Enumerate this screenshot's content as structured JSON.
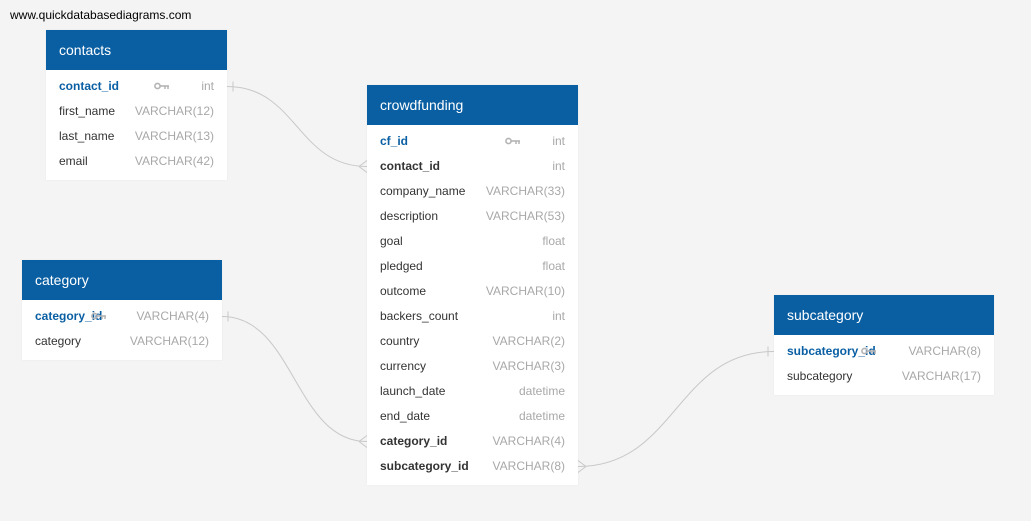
{
  "site": "www.quickdatabasediagrams.com",
  "colors": {
    "header": "#0a5fa3",
    "primary_key": "#0a5fa3",
    "type": "#a8a8a8",
    "link": "#c8c8c8",
    "background": "#f3f4f3"
  },
  "tables": {
    "contacts": {
      "title": "contacts",
      "columns": [
        {
          "name": "contact_id",
          "type": "int",
          "pk": true,
          "fk": false
        },
        {
          "name": "first_name",
          "type": "VARCHAR(12)",
          "pk": false,
          "fk": false
        },
        {
          "name": "last_name",
          "type": "VARCHAR(13)",
          "pk": false,
          "fk": false
        },
        {
          "name": "email",
          "type": "VARCHAR(42)",
          "pk": false,
          "fk": false
        }
      ]
    },
    "category": {
      "title": "category",
      "columns": [
        {
          "name": "category_id",
          "type": "VARCHAR(4)",
          "pk": true,
          "fk": false
        },
        {
          "name": "category",
          "type": "VARCHAR(12)",
          "pk": false,
          "fk": false
        }
      ]
    },
    "crowdfunding": {
      "title": "crowdfunding",
      "columns": [
        {
          "name": "cf_id",
          "type": "int",
          "pk": true,
          "fk": false
        },
        {
          "name": "contact_id",
          "type": "int",
          "pk": false,
          "fk": true
        },
        {
          "name": "company_name",
          "type": "VARCHAR(33)",
          "pk": false,
          "fk": false
        },
        {
          "name": "description",
          "type": "VARCHAR(53)",
          "pk": false,
          "fk": false
        },
        {
          "name": "goal",
          "type": "float",
          "pk": false,
          "fk": false
        },
        {
          "name": "pledged",
          "type": "float",
          "pk": false,
          "fk": false
        },
        {
          "name": "outcome",
          "type": "VARCHAR(10)",
          "pk": false,
          "fk": false
        },
        {
          "name": "backers_count",
          "type": "int",
          "pk": false,
          "fk": false
        },
        {
          "name": "country",
          "type": "VARCHAR(2)",
          "pk": false,
          "fk": false
        },
        {
          "name": "currency",
          "type": "VARCHAR(3)",
          "pk": false,
          "fk": false
        },
        {
          "name": "launch_date",
          "type": "datetime",
          "pk": false,
          "fk": false
        },
        {
          "name": "end_date",
          "type": "datetime",
          "pk": false,
          "fk": false
        },
        {
          "name": "category_id",
          "type": "VARCHAR(4)",
          "pk": false,
          "fk": true
        },
        {
          "name": "subcategory_id",
          "type": "VARCHAR(8)",
          "pk": false,
          "fk": true
        }
      ]
    },
    "subcategory": {
      "title": "subcategory",
      "columns": [
        {
          "name": "subcategory_id",
          "type": "VARCHAR(8)",
          "pk": true,
          "fk": false
        },
        {
          "name": "subcategory",
          "type": "VARCHAR(17)",
          "pk": false,
          "fk": false
        }
      ]
    }
  },
  "relationships": [
    {
      "from": "contacts.contact_id",
      "to": "crowdfunding.contact_id",
      "cardinality": "one-to-many"
    },
    {
      "from": "category.category_id",
      "to": "crowdfunding.category_id",
      "cardinality": "one-to-many"
    },
    {
      "from": "subcategory.subcategory_id",
      "to": "crowdfunding.subcategory_id",
      "cardinality": "one-to-many"
    }
  ]
}
